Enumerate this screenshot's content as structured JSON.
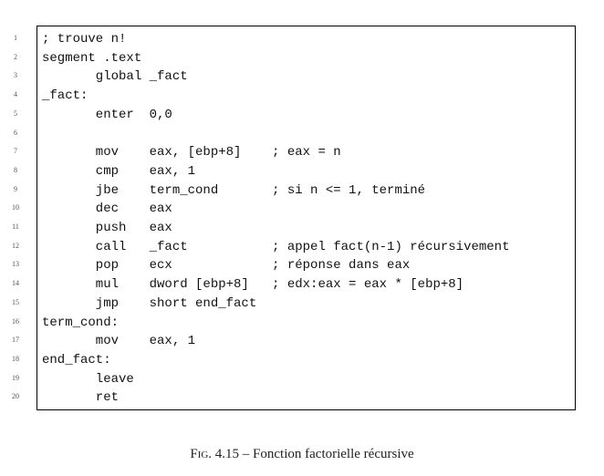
{
  "listing": {
    "lines": [
      {
        "num": "1",
        "code": "; trouve n!"
      },
      {
        "num": "2",
        "code": "segment .text"
      },
      {
        "num": "3",
        "code": "       global _fact"
      },
      {
        "num": "4",
        "code": "_fact:"
      },
      {
        "num": "5",
        "code": "       enter  0,0"
      },
      {
        "num": "6",
        "code": ""
      },
      {
        "num": "7",
        "code": "       mov    eax, [ebp+8]    ; eax = n"
      },
      {
        "num": "8",
        "code": "       cmp    eax, 1"
      },
      {
        "num": "9",
        "code": "       jbe    term_cond       ; si n <= 1, terminé"
      },
      {
        "num": "10",
        "code": "       dec    eax"
      },
      {
        "num": "11",
        "code": "       push   eax"
      },
      {
        "num": "12",
        "code": "       call   _fact           ; appel fact(n-1) récursivement"
      },
      {
        "num": "13",
        "code": "       pop    ecx             ; réponse dans eax"
      },
      {
        "num": "14",
        "code": "       mul    dword [ebp+8]   ; edx:eax = eax * [ebp+8]"
      },
      {
        "num": "15",
        "code": "       jmp    short end_fact"
      },
      {
        "num": "16",
        "code": "term_cond:"
      },
      {
        "num": "17",
        "code": "       mov    eax, 1"
      },
      {
        "num": "18",
        "code": "end_fact:"
      },
      {
        "num": "19",
        "code": "       leave"
      },
      {
        "num": "20",
        "code": "       ret"
      }
    ]
  },
  "caption": {
    "fig_label": "Fig.",
    "fig_number": "4.15",
    "separator": "–",
    "text": "Fonction factorielle récursive"
  }
}
